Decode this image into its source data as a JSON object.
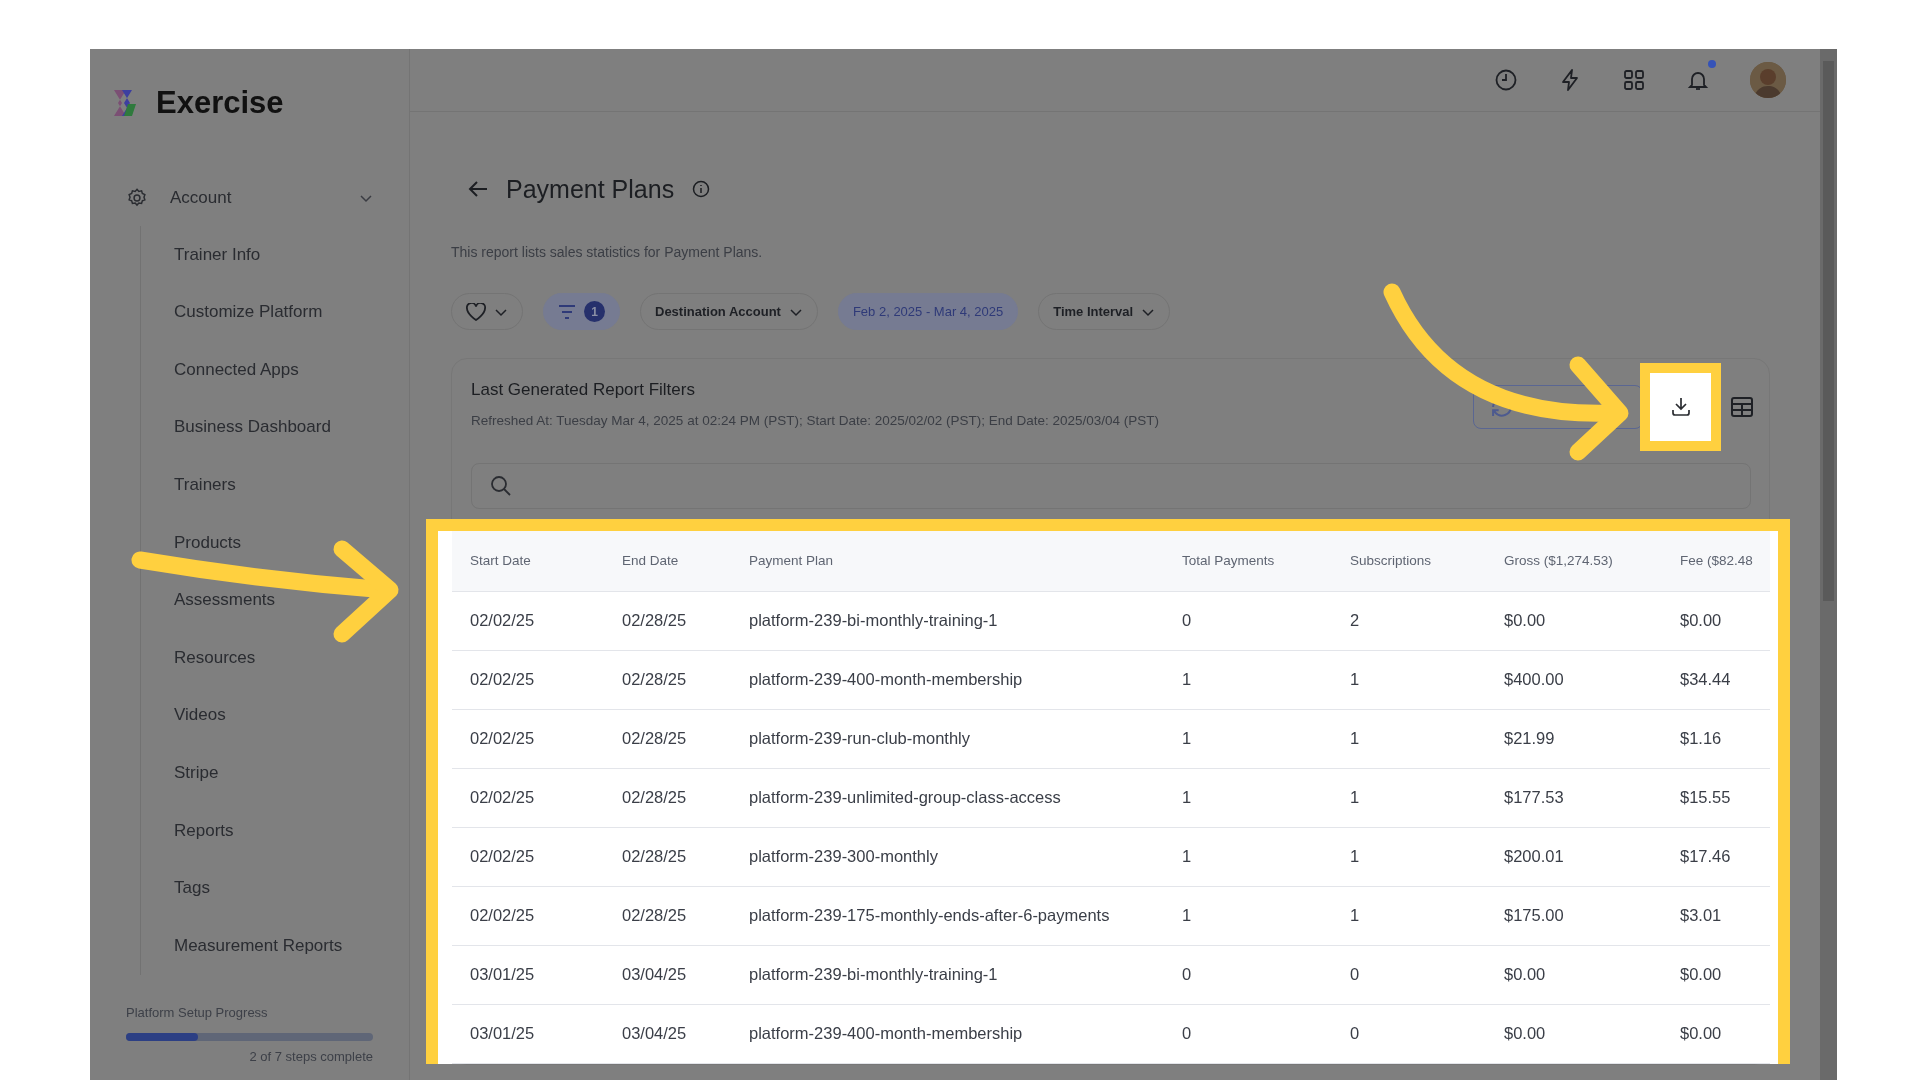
{
  "app": {
    "name": "Exercise"
  },
  "sidebar": {
    "section": {
      "label": "Account",
      "expanded": true
    },
    "items": [
      {
        "label": "Trainer Info"
      },
      {
        "label": "Customize Platform"
      },
      {
        "label": "Connected Apps"
      },
      {
        "label": "Business Dashboard"
      },
      {
        "label": "Trainers"
      },
      {
        "label": "Products"
      },
      {
        "label": "Assessments"
      },
      {
        "label": "Resources"
      },
      {
        "label": "Videos"
      },
      {
        "label": "Stripe"
      },
      {
        "label": "Reports"
      },
      {
        "label": "Tags"
      },
      {
        "label": "Measurement Reports"
      }
    ],
    "setup_progress": {
      "label": "Platform Setup Progress",
      "level": 0.29,
      "caption": "2 of 7 steps complete"
    }
  },
  "topbar": {
    "notifications_unread": true
  },
  "page": {
    "title": "Payment Plans",
    "description": "This report lists sales statistics for Payment Plans."
  },
  "filters": [
    {
      "kind": "favorite"
    },
    {
      "kind": "filter",
      "count": "1"
    },
    {
      "kind": "dropdown",
      "label": "Destination Account",
      "active": false
    },
    {
      "kind": "range",
      "label": "Feb 2, 2025 - Mar 4, 2025",
      "active": true
    },
    {
      "kind": "dropdown",
      "label": "Time Interval",
      "active": false
    }
  ],
  "report": {
    "title": "Last Generated Report Filters",
    "refreshed": "Refreshed At: Tuesday Mar 4, 2025 at 02:24 PM (PST); Start Date: 2025/02/02 (PST); End Date: 2025/03/04 (PST)",
    "download": {
      "highlighted": true
    }
  },
  "table": {
    "highlighted": true,
    "columns": [
      "Start Date",
      "End Date",
      "Payment Plan",
      "Total Payments",
      "Subscriptions",
      "Gross ($1,274.53)",
      "Fee ($82.48"
    ],
    "rows": [
      [
        "02/02/25",
        "02/28/25",
        "platform-239-bi-monthly-training-1",
        "0",
        "2",
        "$0.00",
        "$0.00"
      ],
      [
        "02/02/25",
        "02/28/25",
        "platform-239-400-month-membership",
        "1",
        "1",
        "$400.00",
        "$34.44"
      ],
      [
        "02/02/25",
        "02/28/25",
        "platform-239-run-club-monthly",
        "1",
        "1",
        "$21.99",
        "$1.16"
      ],
      [
        "02/02/25",
        "02/28/25",
        "platform-239-unlimited-group-class-access",
        "1",
        "1",
        "$177.53",
        "$15.55"
      ],
      [
        "02/02/25",
        "02/28/25",
        "platform-239-300-monthly",
        "1",
        "1",
        "$200.01",
        "$17.46"
      ],
      [
        "02/02/25",
        "02/28/25",
        "platform-239-175-monthly-ends-after-6-payments",
        "1",
        "1",
        "$175.00",
        "$3.01"
      ],
      [
        "03/01/25",
        "03/04/25",
        "platform-239-bi-monthly-training-1",
        "0",
        "0",
        "$0.00",
        "$0.00"
      ],
      [
        "03/01/25",
        "03/04/25",
        "platform-239-400-month-membership",
        "0",
        "0",
        "$0.00",
        "$0.00"
      ]
    ]
  }
}
